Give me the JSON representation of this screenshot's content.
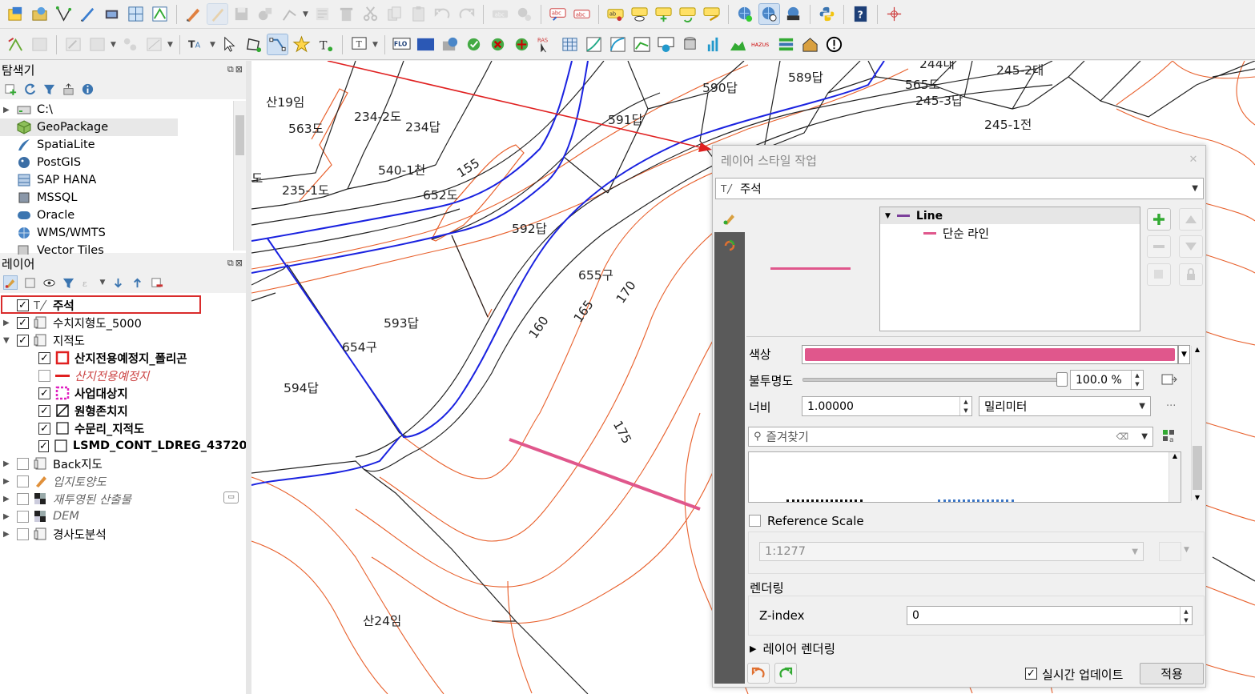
{
  "toolbar1": {
    "icons": [
      "new-project-icon",
      "open-data-source-icon",
      "digitize-vertex-icon",
      "new-layer-icon",
      "gps-icon",
      "grid-icon",
      "vertex-tool-icon",
      "edit-pencil-icon",
      "toggle-edit-icon",
      "save-edits-icon",
      "add-record-icon",
      "digitize-icon",
      "node-icon",
      "delete-icon",
      "cut-icon",
      "copy-icon",
      "paste-icon",
      "undo-icon",
      "redo-icon",
      "label-abc-icon",
      "label-pin-icon",
      "label-abc-red-icon",
      "label-abc-red2-icon",
      "label-yellow-icon",
      "label-show-icon",
      "label-move-icon",
      "label-rotate-icon",
      "label-change-icon",
      "georef-icon",
      "georef-active-icon",
      "ortho-icon",
      "python-icon",
      "help-icon",
      "crosshair-icon"
    ]
  },
  "toolbar2": {
    "ras_label": "RAS",
    "hazus_label": "HAZUS",
    "flo_label": "FLO"
  },
  "browser": {
    "title": "탐색기",
    "items": [
      {
        "label": "C:\\",
        "icon": "drive-icon",
        "arrow": "▶"
      },
      {
        "label": "GeoPackage",
        "icon": "geopackage-icon",
        "arrow": ""
      },
      {
        "label": "SpatiaLite",
        "icon": "spatialite-icon",
        "arrow": ""
      },
      {
        "label": "PostGIS",
        "icon": "postgis-icon",
        "arrow": ""
      },
      {
        "label": "SAP HANA",
        "icon": "sap-hana-icon",
        "arrow": ""
      },
      {
        "label": "MSSQL",
        "icon": "mssql-icon",
        "arrow": ""
      },
      {
        "label": "Oracle",
        "icon": "oracle-icon",
        "arrow": ""
      },
      {
        "label": "WMS/WMTS",
        "icon": "wms-icon",
        "arrow": ""
      },
      {
        "label": "Vector Tiles",
        "icon": "vector-tiles-icon",
        "arrow": ""
      }
    ]
  },
  "layers": {
    "title": "레이어",
    "items": [
      {
        "label": "주석",
        "checked": true,
        "indent": 0,
        "arrow": "",
        "style": "bold",
        "icon": "annotation-layer-icon"
      },
      {
        "label": "수치지형도_5000",
        "checked": true,
        "indent": 0,
        "arrow": "▶",
        "style": "",
        "icon": "group-icon"
      },
      {
        "label": "지적도",
        "checked": true,
        "indent": 0,
        "arrow": "▼",
        "style": "",
        "icon": "group-icon"
      },
      {
        "label": "산지전용예정지_폴리곤",
        "checked": true,
        "indent": 1,
        "arrow": "",
        "style": "bold",
        "icon": "polygon-red-icon"
      },
      {
        "label": "산지전용예정지",
        "checked": false,
        "indent": 1,
        "arrow": "",
        "style": "ital-red",
        "icon": "line-red-icon"
      },
      {
        "label": "사업대상지",
        "checked": true,
        "indent": 1,
        "arrow": "",
        "style": "bold",
        "icon": "polygon-dashed-magenta-icon"
      },
      {
        "label": "원형존치지",
        "checked": true,
        "indent": 1,
        "arrow": "",
        "style": "bold",
        "icon": "polygon-hatched-icon"
      },
      {
        "label": "수문리_지적도",
        "checked": true,
        "indent": 1,
        "arrow": "",
        "style": "bold",
        "icon": "polygon-white-icon"
      },
      {
        "label": "LSMD_CONT_LDREG_43720",
        "checked": true,
        "indent": 1,
        "arrow": "",
        "style": "bold",
        "icon": "polygon-white-icon"
      },
      {
        "label": "Back지도",
        "checked": false,
        "indent": 0,
        "arrow": "▶",
        "style": "",
        "icon": "group-icon"
      },
      {
        "label": "입지토양도",
        "checked": false,
        "indent": 0,
        "arrow": "▶",
        "style": "ital",
        "icon": "soil-layer-icon"
      },
      {
        "label": "재투영된 산출물",
        "checked": false,
        "indent": 0,
        "arrow": "▶",
        "style": "ital",
        "icon": "raster-icon"
      },
      {
        "label": "DEM",
        "checked": false,
        "indent": 0,
        "arrow": "▶",
        "style": "ital",
        "icon": "raster-icon"
      },
      {
        "label": "경사도분석",
        "checked": false,
        "indent": 0,
        "arrow": "▶",
        "style": "",
        "icon": "group-icon"
      }
    ]
  },
  "map": {
    "labels": [
      {
        "text": "산19임"
      },
      {
        "text": "563도"
      },
      {
        "text": "234-2도"
      },
      {
        "text": "234답"
      },
      {
        "text": "540-1천"
      },
      {
        "text": "155"
      },
      {
        "text": "652도"
      },
      {
        "text": "235-1도"
      },
      {
        "text": "590답"
      },
      {
        "text": "589답"
      },
      {
        "text": "565도"
      },
      {
        "text": "245-3답"
      },
      {
        "text": "245-2대"
      },
      {
        "text": "245-1전"
      },
      {
        "text": "591답"
      },
      {
        "text": "592답"
      },
      {
        "text": "655구"
      },
      {
        "text": "170"
      },
      {
        "text": "165"
      },
      {
        "text": "160"
      },
      {
        "text": "593답"
      },
      {
        "text": "654구"
      },
      {
        "text": "594답"
      },
      {
        "text": "175"
      },
      {
        "text": "산24임"
      },
      {
        "text": "도"
      },
      {
        "text": "244대"
      }
    ]
  },
  "dialog": {
    "title": "레이어 스타일 작업",
    "layer_select": "주석",
    "tree_root": "Line",
    "tree_child": "단순 라인",
    "color_label": "색상",
    "color_value": "#e0578c",
    "opacity_label": "불투명도",
    "opacity_value": "100.0 %",
    "opacity_level": 1.0,
    "width_label": "너비",
    "width_value": "1.00000",
    "unit_value": "밀리미터",
    "favorites_placeholder": "즐겨찾기",
    "reference_scale_label": "Reference Scale",
    "reference_scale_value": "1:1277",
    "rendering_header": "렌더링",
    "zindex_label": "Z-index",
    "zindex_value": "0",
    "layer_rendering_label": "레이어 렌더링",
    "live_update_label": "실시간 업데이트",
    "apply_label": "적용"
  }
}
